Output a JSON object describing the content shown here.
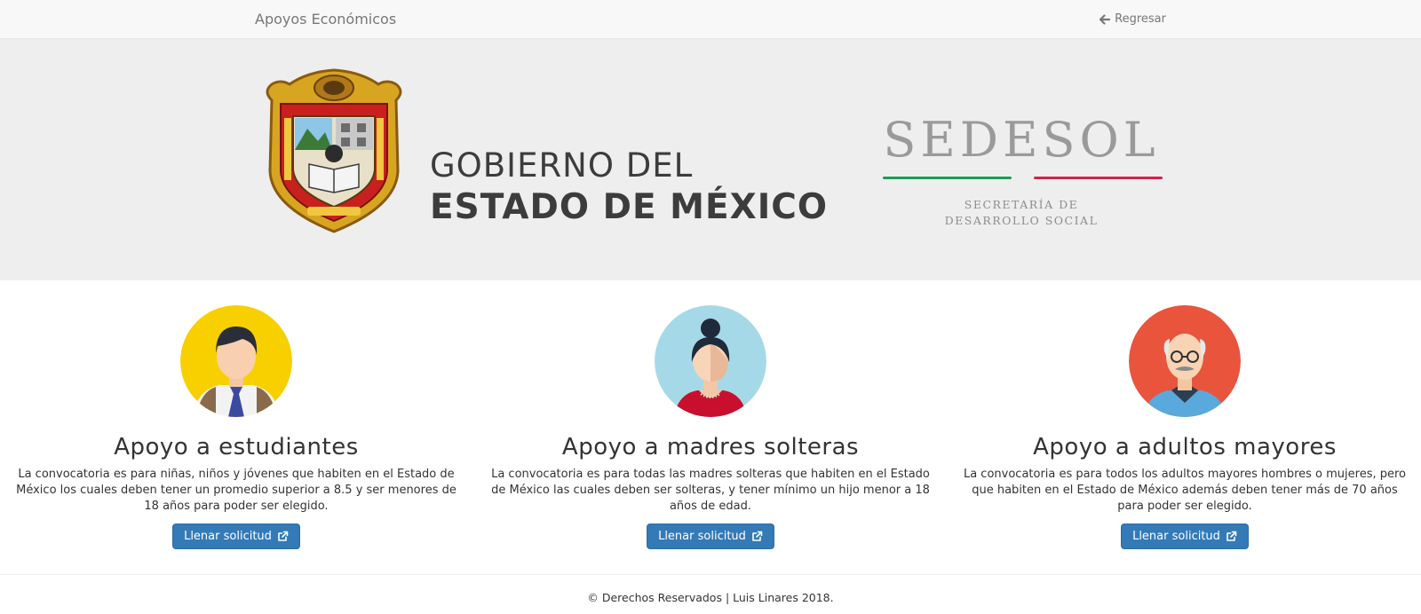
{
  "navbar": {
    "brand": "Apoyos Económicos",
    "back_label": "Regresar",
    "back_icon": "arrow-left-icon"
  },
  "banner": {
    "gov_line1": "GOBIERNO DEL",
    "gov_line2": "ESTADO DE MÉXICO",
    "sedesol_name": "SEDESOL",
    "sedesol_sub_line1": "SECRETARÍA DE",
    "sedesol_sub_line2": "DESARROLLO SOCIAL",
    "colors": {
      "green": "#1e9a55",
      "red": "#d6204a",
      "background": "#eeeeee"
    }
  },
  "cards": [
    {
      "title": "Apoyo a estudiantes",
      "text": "La convocatoria es para niñas, niños y jóvenes que habiten en el Estado de México los cuales deben tener un promedio superior a 8.5 y ser menores de 18 años para poder ser elegido.",
      "button": "Llenar solicitud",
      "avatar": "student-avatar-icon",
      "avatar_bg": "#f8d000"
    },
    {
      "title": "Apoyo a madres solteras",
      "text": "La convocatoria es para todas las madres solteras que habiten en el Estado de México las cuales deben ser solteras, y tener mínimo un hijo menor a 18 años de edad.",
      "button": "Llenar solicitud",
      "avatar": "woman-avatar-icon",
      "avatar_bg": "#a6d9e8"
    },
    {
      "title": "Apoyo a adultos mayores",
      "text": "La convocatoria es para todos los adultos mayores hombres o mujeres, pero que habiten en el Estado de México además deben tener más de 70 años para poder ser elegido.",
      "button": "Llenar solicitud",
      "avatar": "elderly-man-avatar-icon",
      "avatar_bg": "#e9543d"
    }
  ],
  "footer": {
    "text": "© Derechos Reservados | Luis Linares 2018."
  },
  "colors": {
    "primary_button": "#337ab7",
    "navbar_bg": "#f8f8f8"
  }
}
